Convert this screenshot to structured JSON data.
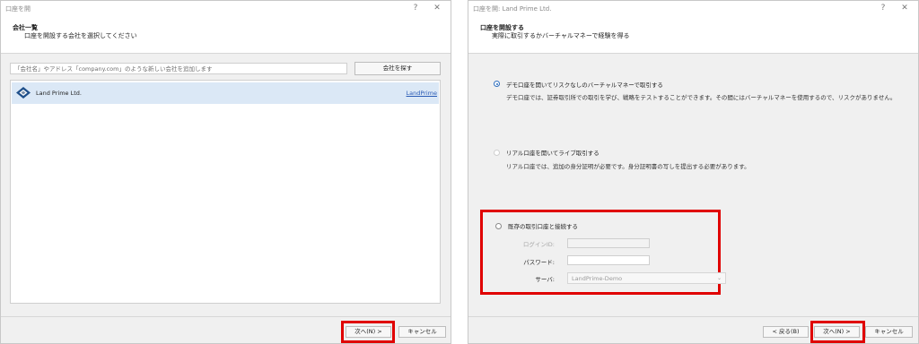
{
  "window1": {
    "title": "口座を開",
    "help": "?",
    "close": "✕",
    "header_title": "会社一覧",
    "header_subtitle": "口座を開設する会社を選択してください",
    "search_placeholder": "「会社名」やアドレス「company.com」のような新しい会社を追加します",
    "find_button": "会社を探す",
    "companies": [
      {
        "name": "Land Prime Ltd.",
        "link": "LandPrime"
      }
    ],
    "next_button": "次へ(N) >",
    "cancel_button": "キャンセル"
  },
  "window2": {
    "title": "口座を開: Land Prime Ltd.",
    "help": "?",
    "close": "✕",
    "header_title": "口座を開設する",
    "header_subtitle": "実際に取引するかバーチャルマネーで経験を得る",
    "option_demo_label": "デモ口座を開いてリスクなしのバーチャルマネーで取引する",
    "option_demo_desc": "デモ口座では、証券取引所での取引を学び、戦略をテストすることができます。その間にはバーチャルマネーを使用するので、リスクがありません。",
    "option_real_label": "リアル口座を開いてライブ取引する",
    "option_real_desc": "リアル口座では、追加の身分証明が必要です。身分証明書の写しを提出する必要があります。",
    "option_existing_label": "既存の取引口座と接続する",
    "login_label": "ログインID:",
    "password_label": "パスワード:",
    "server_label": "サーバ:",
    "server_value": "LandPrime-Demo",
    "back_button": "< 戻る(B)",
    "next_button": "次へ(N) >",
    "cancel_button": "キャンセル"
  },
  "colors": {
    "highlight": "#e00000",
    "selected_row": "#dbe8f6",
    "radio_checked": "#2f6fbf",
    "link": "#2a5bb5"
  }
}
